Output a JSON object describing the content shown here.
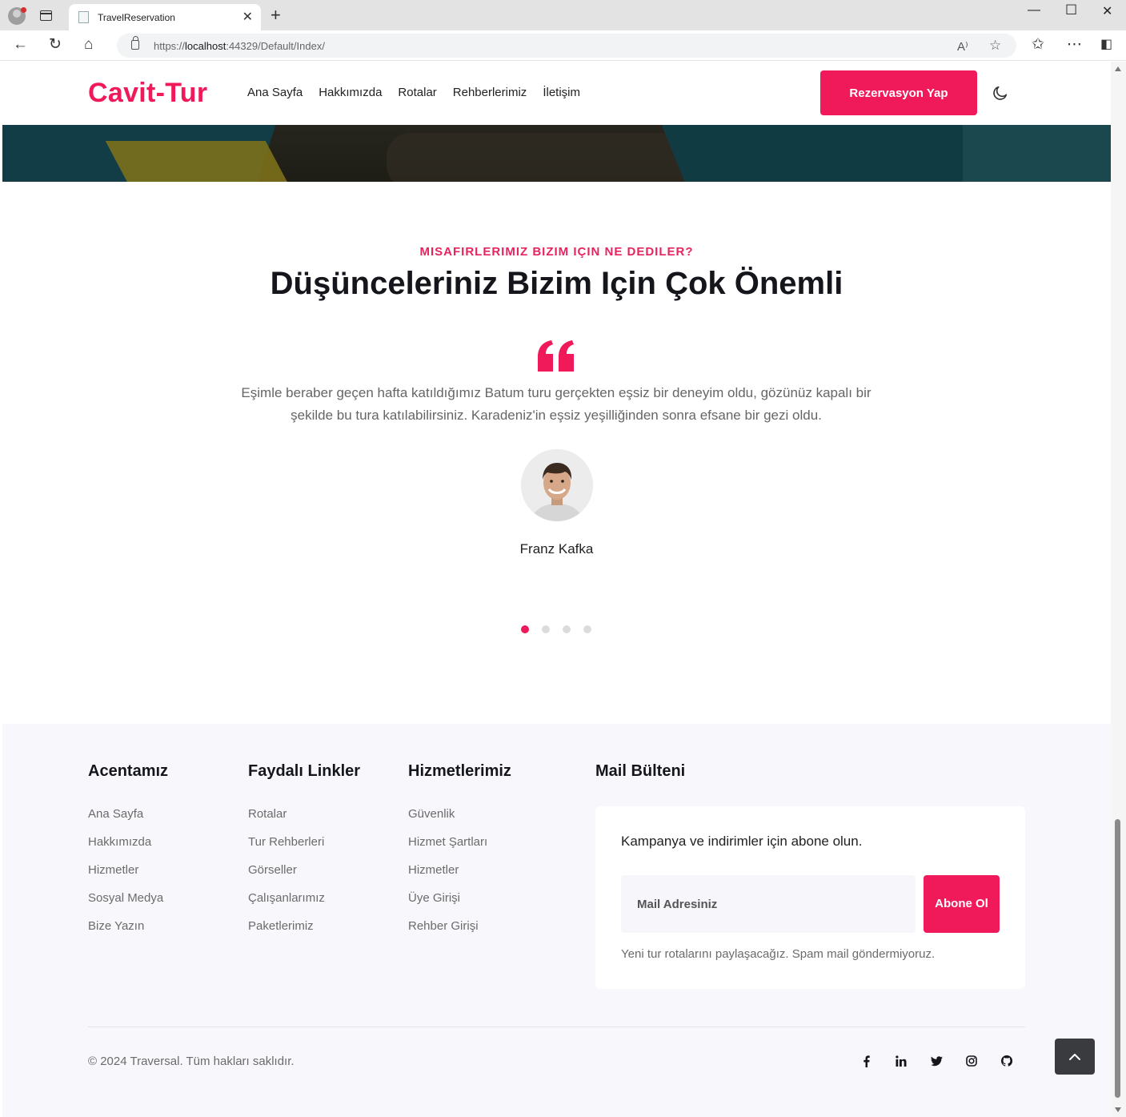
{
  "browser": {
    "tab_title": "TravelReservation",
    "url_prefix": "https://",
    "url_host": "localhost",
    "url_rest": ":44329/Default/Index/"
  },
  "navbar": {
    "brand": "Cavit-Tur",
    "links": [
      "Ana Sayfa",
      "Hakkımızda",
      "Rotalar",
      "Rehberlerimiz",
      "İletişim"
    ],
    "cta": "Rezervasyon Yap"
  },
  "testimonials": {
    "subtitle": "MISAFIRLERIMIZ BIZIM IÇIN NE DEDILER?",
    "title": "Düşünceleriniz Bizim Için Çok Önemli",
    "text": "Eşimle beraber geçen hafta katıldığımız Batum turu gerçekten eşsiz bir deneyim oldu, gözünüz kapalı bir şekilde bu tura katılabilirsiniz. Karadeniz'in eşsiz yeşilliğinden sonra efsane bir gezi oldu.",
    "name": "Franz Kafka",
    "slide_count": 4,
    "active_slide": 1
  },
  "footer": {
    "col1": {
      "title": "Acentamız",
      "items": [
        "Ana Sayfa",
        "Hakkımızda",
        "Hizmetler",
        "Sosyal Medya",
        "Bize Yazın"
      ]
    },
    "col2": {
      "title": "Faydalı Linkler",
      "items": [
        "Rotalar",
        "Tur Rehberleri",
        "Görseller",
        "Çalışanlarımız",
        "Paketlerimiz"
      ]
    },
    "col3": {
      "title": "Hizmetlerimiz",
      "items": [
        "Güvenlik",
        "Hizmet Şartları",
        "Hizmetler",
        "Üye Girişi",
        "Rehber Girişi"
      ]
    },
    "newsletter": {
      "title": "Mail Bülteni",
      "text": "Kampanya ve indirimler için abone olun.",
      "placeholder": "Mail Adresiniz",
      "button": "Abone Ol",
      "note": "Yeni tur rotalarını paylaşacağız. Spam mail göndermiyoruz."
    },
    "copyright": "© 2024 Traversal. Tüm hakları saklıdır.",
    "socials": [
      "facebook-icon",
      "linkedin-icon",
      "twitter-icon",
      "instagram-icon",
      "github-icon"
    ]
  },
  "colors": {
    "accent": "#f0195a",
    "footer_bg": "#f8f8fc"
  }
}
